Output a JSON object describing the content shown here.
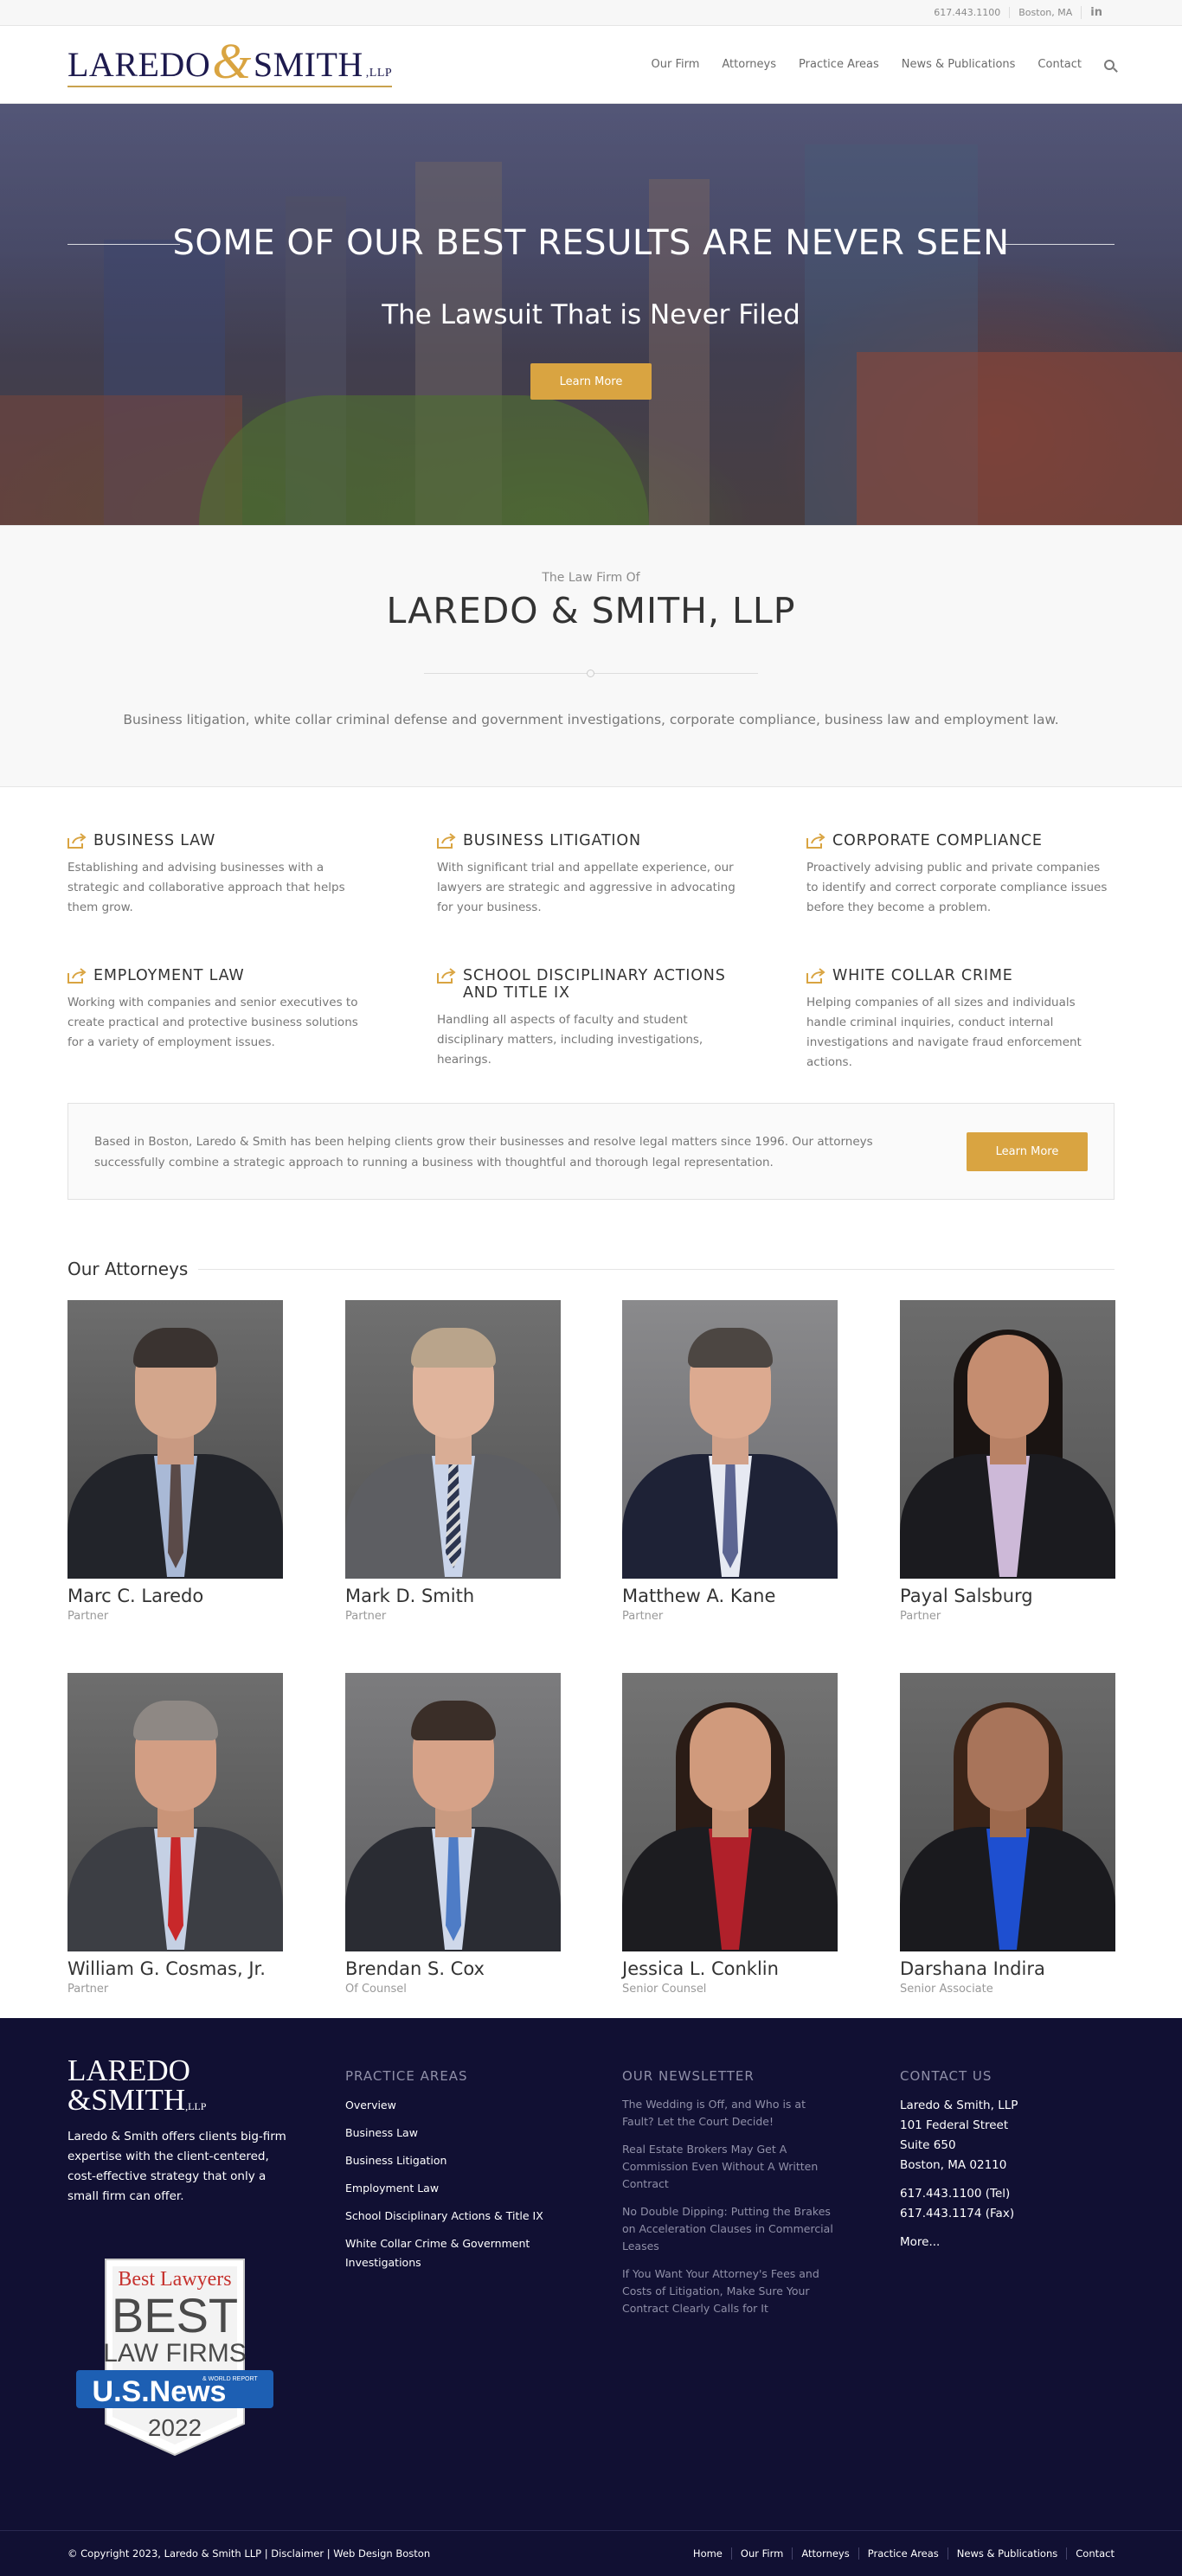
{
  "topbar": {
    "phone": "617.443.1100",
    "location": "Boston, MA",
    "social_icon": "linkedin-icon",
    "social_text": "in"
  },
  "logo": {
    "name1": "LAREDO",
    "amp": "&",
    "name2": "SMITH",
    "llp": ",LLP"
  },
  "nav": [
    "Our Firm",
    "Attorneys",
    "Practice Areas",
    "News & Publications",
    "Contact"
  ],
  "hero": {
    "title": "SOME OF OUR BEST RESULTS ARE NEVER SEEN",
    "subtitle": "The Lawsuit That is Never Filed",
    "button": "Learn More"
  },
  "intro": {
    "pre": "The Law Firm Of",
    "title": "LAREDO & SMITH, LLP",
    "desc": "Business litigation, white collar criminal defense and government investigations, corporate compliance, business law and employment law."
  },
  "services": [
    {
      "title": "BUSINESS LAW",
      "desc": "Establishing and advising businesses with a strategic and collaborative approach that helps them grow."
    },
    {
      "title": "BUSINESS LITIGATION",
      "desc": "With significant trial and appellate experience, our lawyers are strategic and aggressive in advocating for your business."
    },
    {
      "title": "CORPORATE COMPLIANCE",
      "desc": "Proactively advising public and private companies to identify and correct corporate compliance issues before they become a problem."
    },
    {
      "title": "EMPLOYMENT LAW",
      "desc": "Working with companies and senior executives to create practical and protective business solutions for a variety of employment issues."
    },
    {
      "title": "SCHOOL DISCIPLINARY ACTIONS AND TITLE IX",
      "desc": "Handling all aspects of faculty and student disciplinary matters, including investigations, hearings."
    },
    {
      "title": "WHITE COLLAR CRIME",
      "desc": "Helping companies of all sizes and individuals handle criminal inquiries, conduct internal investigations and navigate fraud enforcement actions."
    }
  ],
  "cta": {
    "text": "Based in Boston, Laredo & Smith has been helping clients grow their businesses and resolve legal matters since 1996. Our attorneys successfully combine a strategic approach to running a business with thoughtful and thorough legal representation.",
    "button": "Learn More"
  },
  "attorneys": {
    "heading": "Our Attorneys",
    "people": [
      {
        "name": "Marc C. Laredo",
        "role": "Partner"
      },
      {
        "name": "Mark D. Smith",
        "role": "Partner"
      },
      {
        "name": "Matthew A. Kane",
        "role": "Partner"
      },
      {
        "name": "Payal Salsburg",
        "role": "Partner"
      },
      {
        "name": "William G. Cosmas, Jr.",
        "role": "Partner"
      },
      {
        "name": "Brendan S. Cox",
        "role": "Of Counsel"
      },
      {
        "name": "Jessica L. Conklin",
        "role": "Senior Counsel"
      },
      {
        "name": "Darshana Indira",
        "role": "Senior Associate"
      }
    ]
  },
  "footer": {
    "logo1": "LAREDO",
    "logo2": "&SMITH",
    "logo_llp": ",LLP",
    "about": "Laredo & Smith offers clients big-firm expertise with the client-centered, cost-effective strategy that only a small firm can offer.",
    "badge": {
      "top": "Best Lawyers",
      "mid1": "BEST",
      "mid2": "LAW FIRMS",
      "brand": "U.S.News",
      "sub": "& WORLD REPORT",
      "year": "2022"
    },
    "practice": {
      "heading": "PRACTICE AREAS",
      "links": [
        "Overview",
        "Business Law",
        "Business Litigation",
        "Employment Law",
        "School Disciplinary Actions & Title IX",
        "White Collar Crime & Government Investigations"
      ]
    },
    "newsletter": {
      "heading": "OUR NEWSLETTER",
      "links": [
        "The Wedding is Off, and Who is at Fault? Let the Court Decide!",
        "Real Estate Brokers May Get A Commission Even Without A Written Contract",
        "No Double Dipping: Putting the Brakes on Acceleration Clauses in Commercial Leases",
        "If You Want Your Attorney's Fees and Costs of Litigation, Make Sure Your Contract Clearly Calls for It"
      ]
    },
    "contact": {
      "heading": "CONTACT US",
      "lines": [
        "Laredo & Smith, LLP",
        "101 Federal Street",
        "Suite 650",
        "Boston, MA 02110"
      ],
      "tel": "617.443.1100 (Tel)",
      "fax": "617.443.1174 (Fax)",
      "more": "More..."
    },
    "copyright": "© Copyright 2023, Laredo & Smith LLP | Disclaimer | Web Design Boston",
    "bottom_links": [
      "Home",
      "Our Firm",
      "Attorneys",
      "Practice Areas",
      "News & Publications",
      "Contact"
    ]
  },
  "colors": {
    "accent": "#d9a441",
    "navy": "#111033",
    "logo_navy": "#1d1a4e"
  }
}
